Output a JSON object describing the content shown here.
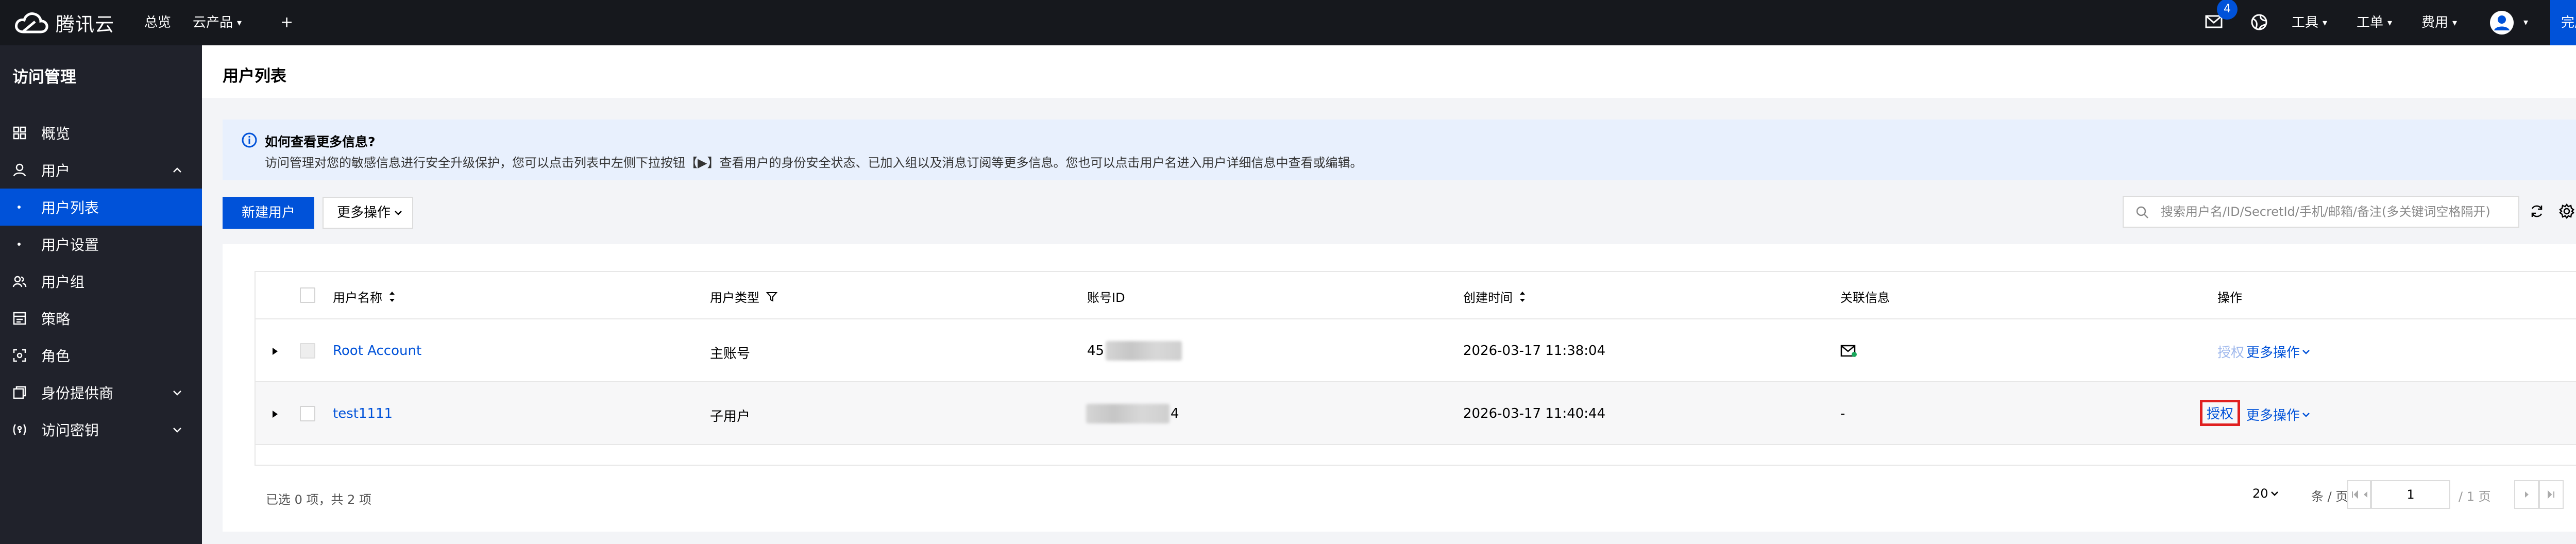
{
  "topnav": {
    "logo_text": "腾讯云",
    "overview": "总览",
    "products": "云产品",
    "plus": "+",
    "mail_badge": "4",
    "tools": "工具",
    "tickets": "工单",
    "billing": "费用",
    "register": "完成注册"
  },
  "sidebar": {
    "title": "访问管理",
    "items": [
      {
        "label": "概览",
        "icon": "grid-icon"
      },
      {
        "label": "用户",
        "icon": "user-icon"
      },
      {
        "label": "用户列表"
      },
      {
        "label": "用户设置"
      },
      {
        "label": "用户组",
        "icon": "user-group-icon"
      },
      {
        "label": "策略",
        "icon": "policy-icon"
      },
      {
        "label": "角色",
        "icon": "role-icon"
      },
      {
        "label": "身份提供商",
        "icon": "identity-provider-icon"
      },
      {
        "label": "访问密钥",
        "icon": "key-icon"
      }
    ]
  },
  "page": {
    "title": "用户列表"
  },
  "info": {
    "title": "如何查看更多信息?",
    "body": "访问管理对您的敏感信息进行安全升级保护，您可以点击列表中左侧下拉按钮【▶】查看用户的身份安全状态、已加入组以及消息订阅等更多信息。您也可以点击用户名进入用户详细信息中查看或编辑。"
  },
  "toolbar": {
    "new_user": "新建用户",
    "more_ops": "更多操作",
    "search_placeholder": "搜索用户名/ID/SecretId/手机/邮箱/备注(多关键词空格隔开)"
  },
  "table": {
    "headers": [
      "用户名称",
      "用户类型",
      "账号ID",
      "创建时间",
      "关联信息",
      "操作"
    ],
    "rows": [
      {
        "name": "Root Account",
        "type": "主账号",
        "id_prefix": "45",
        "id_suffix": "",
        "created": "2026-03-17 11:38:04",
        "assoc": "",
        "auth": "授权",
        "more": "更多操作"
      },
      {
        "name": "test1111",
        "type": "子用户",
        "id_prefix": "",
        "id_suffix": "4",
        "created": "2026-03-17 11:40:44",
        "assoc": "-",
        "auth": "授权",
        "more": "更多操作"
      }
    ]
  },
  "footer": {
    "selected": "已选 0 项，共 2 项",
    "page_size": "20",
    "per_page": "条 / 页",
    "current_page": "1",
    "total_pages": "/ 1 页"
  },
  "colors": {
    "brand": "#0052d9",
    "nav_bg": "#16181d",
    "sidebar_bg": "#20222b",
    "highlight": "#e02020"
  }
}
